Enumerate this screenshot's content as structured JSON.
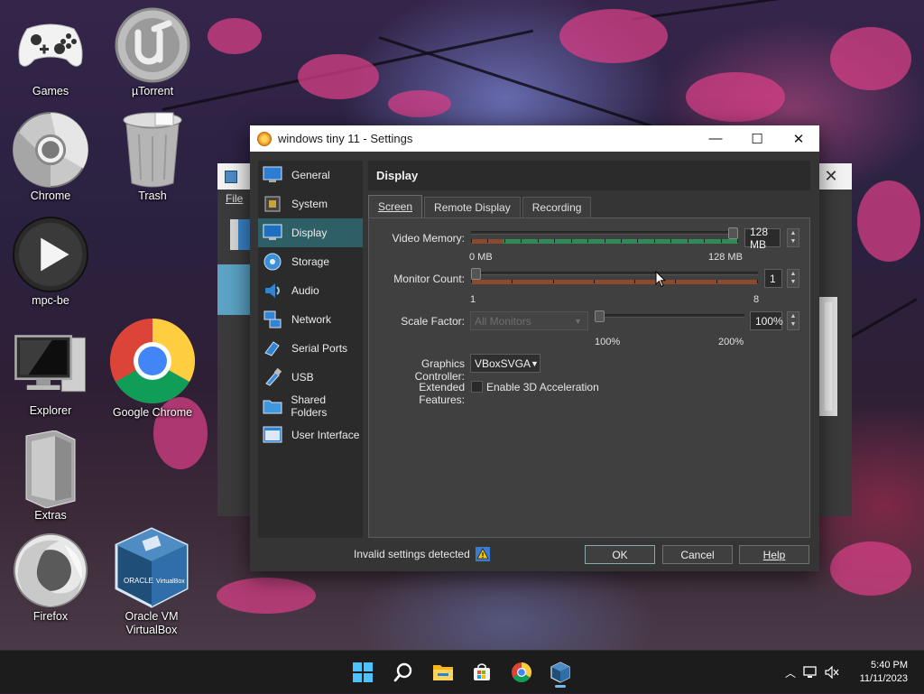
{
  "desktop": {
    "icons": [
      {
        "label": "Games",
        "icon": "gamepad-icon"
      },
      {
        "label": "µTorrent",
        "icon": "utorrent-icon"
      },
      {
        "label": "Chrome",
        "icon": "chrome-metal-icon"
      },
      {
        "label": "Trash",
        "icon": "trash-can-icon"
      },
      {
        "label": "mpc-be",
        "icon": "play-icon"
      },
      {
        "label": "Explorer",
        "icon": "computer-icon"
      },
      {
        "label": "Google Chrome",
        "icon": "chrome-icon"
      },
      {
        "label": "Extras",
        "icon": "folder-glass-icon"
      },
      {
        "label": "Firefox",
        "icon": "firefox-icon"
      },
      {
        "label": "Oracle VM\nVirtualBox",
        "icon": "virtualbox-icon"
      }
    ]
  },
  "background_window": {
    "menu_file": "File"
  },
  "dialog": {
    "title": "windows tiny 11 - Settings",
    "controls": {
      "minimize": "—",
      "maximize": "☐",
      "close": "✕"
    },
    "sidebar": [
      {
        "label": "General",
        "icon": "general-icon"
      },
      {
        "label": "System",
        "icon": "system-chip-icon"
      },
      {
        "label": "Display",
        "icon": "monitor-icon",
        "selected": true
      },
      {
        "label": "Storage",
        "icon": "disk-icon"
      },
      {
        "label": "Audio",
        "icon": "speaker-icon"
      },
      {
        "label": "Network",
        "icon": "network-icon"
      },
      {
        "label": "Serial Ports",
        "icon": "serial-port-icon"
      },
      {
        "label": "USB",
        "icon": "usb-icon"
      },
      {
        "label": "Shared Folders",
        "icon": "folder-icon"
      },
      {
        "label": "User Interface",
        "icon": "window-ui-icon"
      }
    ],
    "section_title": "Display",
    "tabs": [
      {
        "label": "Screen",
        "active": true
      },
      {
        "label": "Remote Display",
        "active": false
      },
      {
        "label": "Recording",
        "active": false
      }
    ],
    "video_memory": {
      "label": "Video Memory:",
      "value": "128 MB",
      "min_label": "0 MB",
      "max_label": "128 MB",
      "level": 1.0
    },
    "monitor_count": {
      "label": "Monitor Count:",
      "value": "1",
      "min_label": "1",
      "max_label": "8",
      "level": 0.0
    },
    "scale_factor": {
      "label": "Scale Factor:",
      "combo": "All Monitors",
      "value": "100%",
      "min_label": "100%",
      "max_label": "200%",
      "level": 0.0
    },
    "graphics_controller": {
      "label": "Graphics Controller:",
      "value": "VBoxSVGA"
    },
    "extended_features": {
      "label": "Extended Features:",
      "checkbox_label": "Enable 3D Acceleration",
      "checked": false
    },
    "footer_message": "Invalid settings detected",
    "buttons": {
      "ok": "OK",
      "cancel": "Cancel",
      "help": "Help"
    }
  },
  "taskbar": {
    "pinned": [
      "start-icon",
      "search-icon",
      "file-explorer-icon",
      "store-icon",
      "chrome-icon",
      "virtualbox-icon"
    ],
    "time": "5:40 PM",
    "date": "11/11/2023"
  },
  "colors": {
    "selected_item": "#2e5e66",
    "memory_band": "#2e8b57",
    "memory_band_low": "#8b4a2e",
    "monitor_band": "#8b4a2e",
    "taskbar": "#1c1c1c"
  }
}
